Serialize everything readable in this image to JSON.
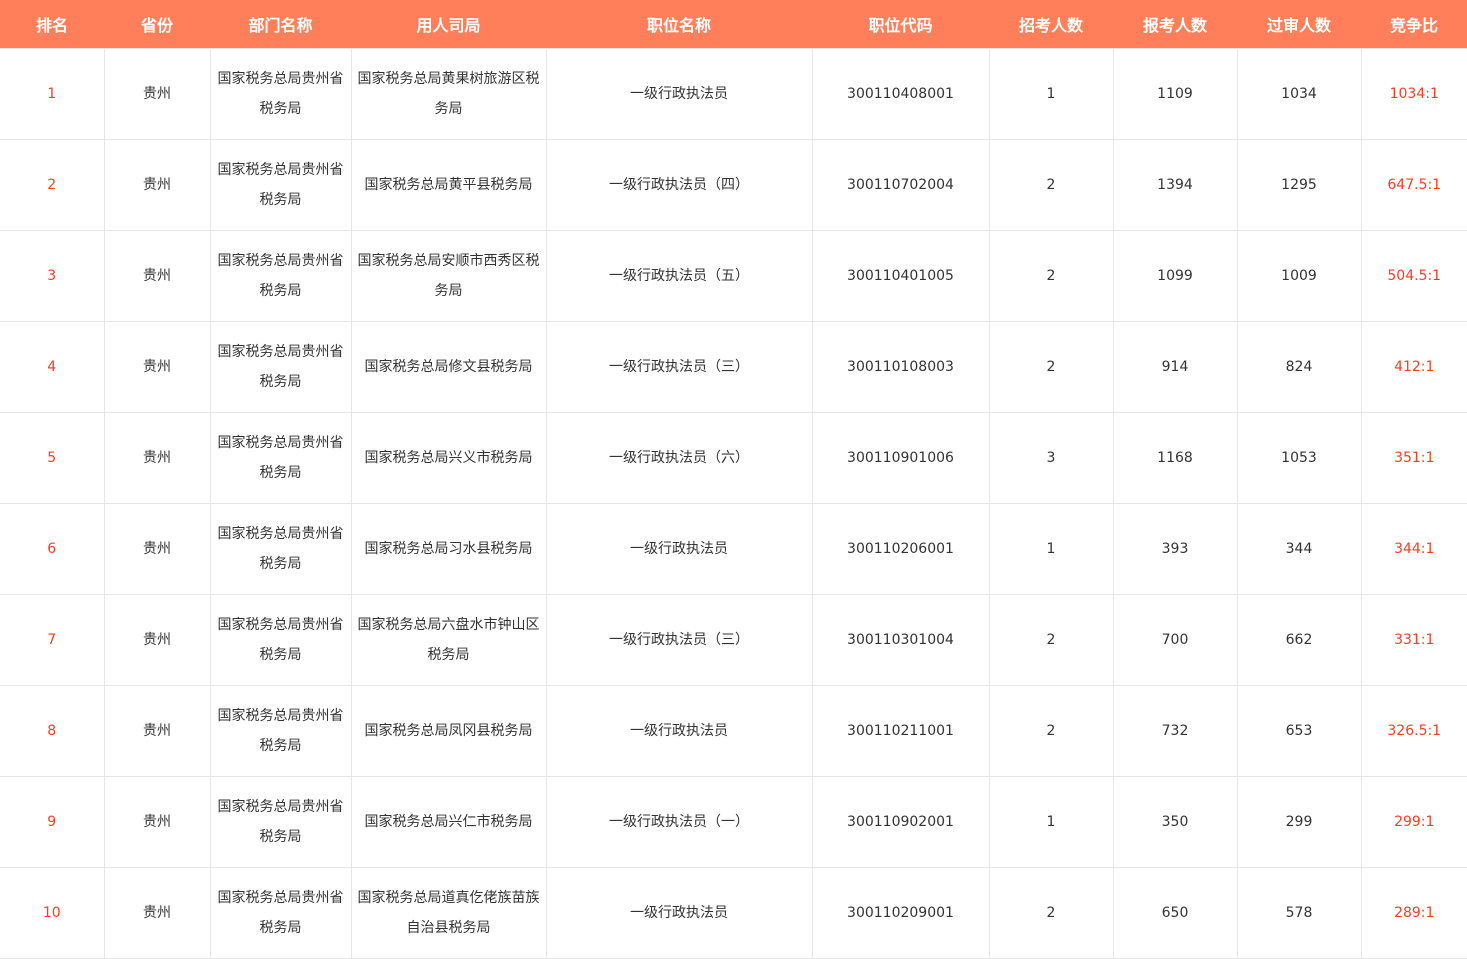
{
  "colors": {
    "header_bg": "#ff7f5a",
    "accent_red": "#ff3b1f"
  },
  "table": {
    "headers": [
      "排名",
      "省份",
      "部门名称",
      "用人司局",
      "职位名称",
      "职位代码",
      "招考人数",
      "报考人数",
      "过审人数",
      "竞争比"
    ],
    "rows": [
      [
        "1",
        "贵州",
        "国家税务总局贵州省税务局",
        "国家税务总局黄果树旅游区税务局",
        "一级行政执法员",
        "300110408001",
        "1",
        "1109",
        "1034",
        "1034:1"
      ],
      [
        "2",
        "贵州",
        "国家税务总局贵州省税务局",
        "国家税务总局黄平县税务局",
        "一级行政执法员（四）",
        "300110702004",
        "2",
        "1394",
        "1295",
        "647.5:1"
      ],
      [
        "3",
        "贵州",
        "国家税务总局贵州省税务局",
        "国家税务总局安顺市西秀区税务局",
        "一级行政执法员（五）",
        "300110401005",
        "2",
        "1099",
        "1009",
        "504.5:1"
      ],
      [
        "4",
        "贵州",
        "国家税务总局贵州省税务局",
        "国家税务总局修文县税务局",
        "一级行政执法员（三）",
        "300110108003",
        "2",
        "914",
        "824",
        "412:1"
      ],
      [
        "5",
        "贵州",
        "国家税务总局贵州省税务局",
        "国家税务总局兴义市税务局",
        "一级行政执法员（六）",
        "300110901006",
        "3",
        "1168",
        "1053",
        "351:1"
      ],
      [
        "6",
        "贵州",
        "国家税务总局贵州省税务局",
        "国家税务总局习水县税务局",
        "一级行政执法员",
        "300110206001",
        "1",
        "393",
        "344",
        "344:1"
      ],
      [
        "7",
        "贵州",
        "国家税务总局贵州省税务局",
        "国家税务总局六盘水市钟山区税务局",
        "一级行政执法员（三）",
        "300110301004",
        "2",
        "700",
        "662",
        "331:1"
      ],
      [
        "8",
        "贵州",
        "国家税务总局贵州省税务局",
        "国家税务总局凤冈县税务局",
        "一级行政执法员",
        "300110211001",
        "2",
        "732",
        "653",
        "326.5:1"
      ],
      [
        "9",
        "贵州",
        "国家税务总局贵州省税务局",
        "国家税务总局兴仁市税务局",
        "一级行政执法员（一）",
        "300110902001",
        "1",
        "350",
        "299",
        "299:1"
      ],
      [
        "10",
        "贵州",
        "国家税务总局贵州省税务局",
        "国家税务总局道真仡佬族苗族自治县税务局",
        "一级行政执法员",
        "300110209001",
        "2",
        "650",
        "578",
        "289:1"
      ]
    ]
  }
}
